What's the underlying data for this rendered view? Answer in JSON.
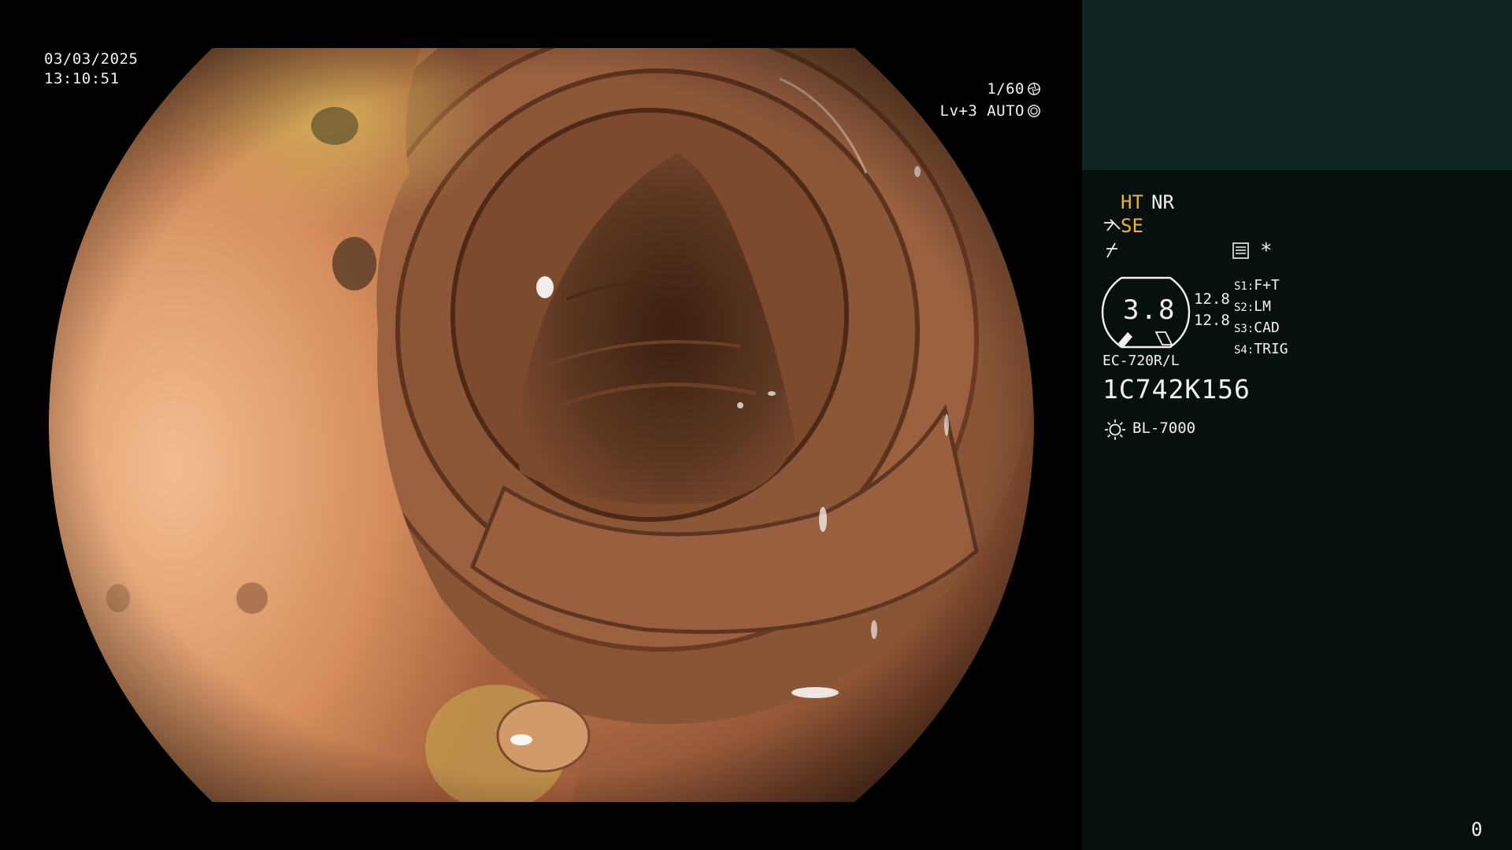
{
  "overlay": {
    "date": "03/03/2025",
    "time": "13:10:51",
    "shutter": "1/60",
    "iris": "Lv+3 AUTO"
  },
  "panel": {
    "mode_ht": "HT",
    "mode_nr": "NR",
    "mode_se": "SE",
    "asterisk": "*",
    "gauge_value": "3.8",
    "value_a": "12.8",
    "value_b": "12.8",
    "switches": [
      {
        "key": "S1:",
        "value": "F+T"
      },
      {
        "key": "S2:",
        "value": "LM"
      },
      {
        "key": "S3:",
        "value": "CAD"
      },
      {
        "key": "S4:",
        "value": "TRIG"
      }
    ],
    "scope_model": "EC-720R/L",
    "serial": "1C742K156",
    "light_source": "BL-7000",
    "counter": "0"
  },
  "colors": {
    "accent_orange": "#f0b030",
    "panel_top": "#0f2624",
    "panel_bottom": "#06110f"
  },
  "icons": [
    "shutter-icon",
    "auto-iris-icon",
    "se-icon",
    "slash-icon",
    "menu-icon",
    "gauge-icon",
    "light-icon"
  ]
}
